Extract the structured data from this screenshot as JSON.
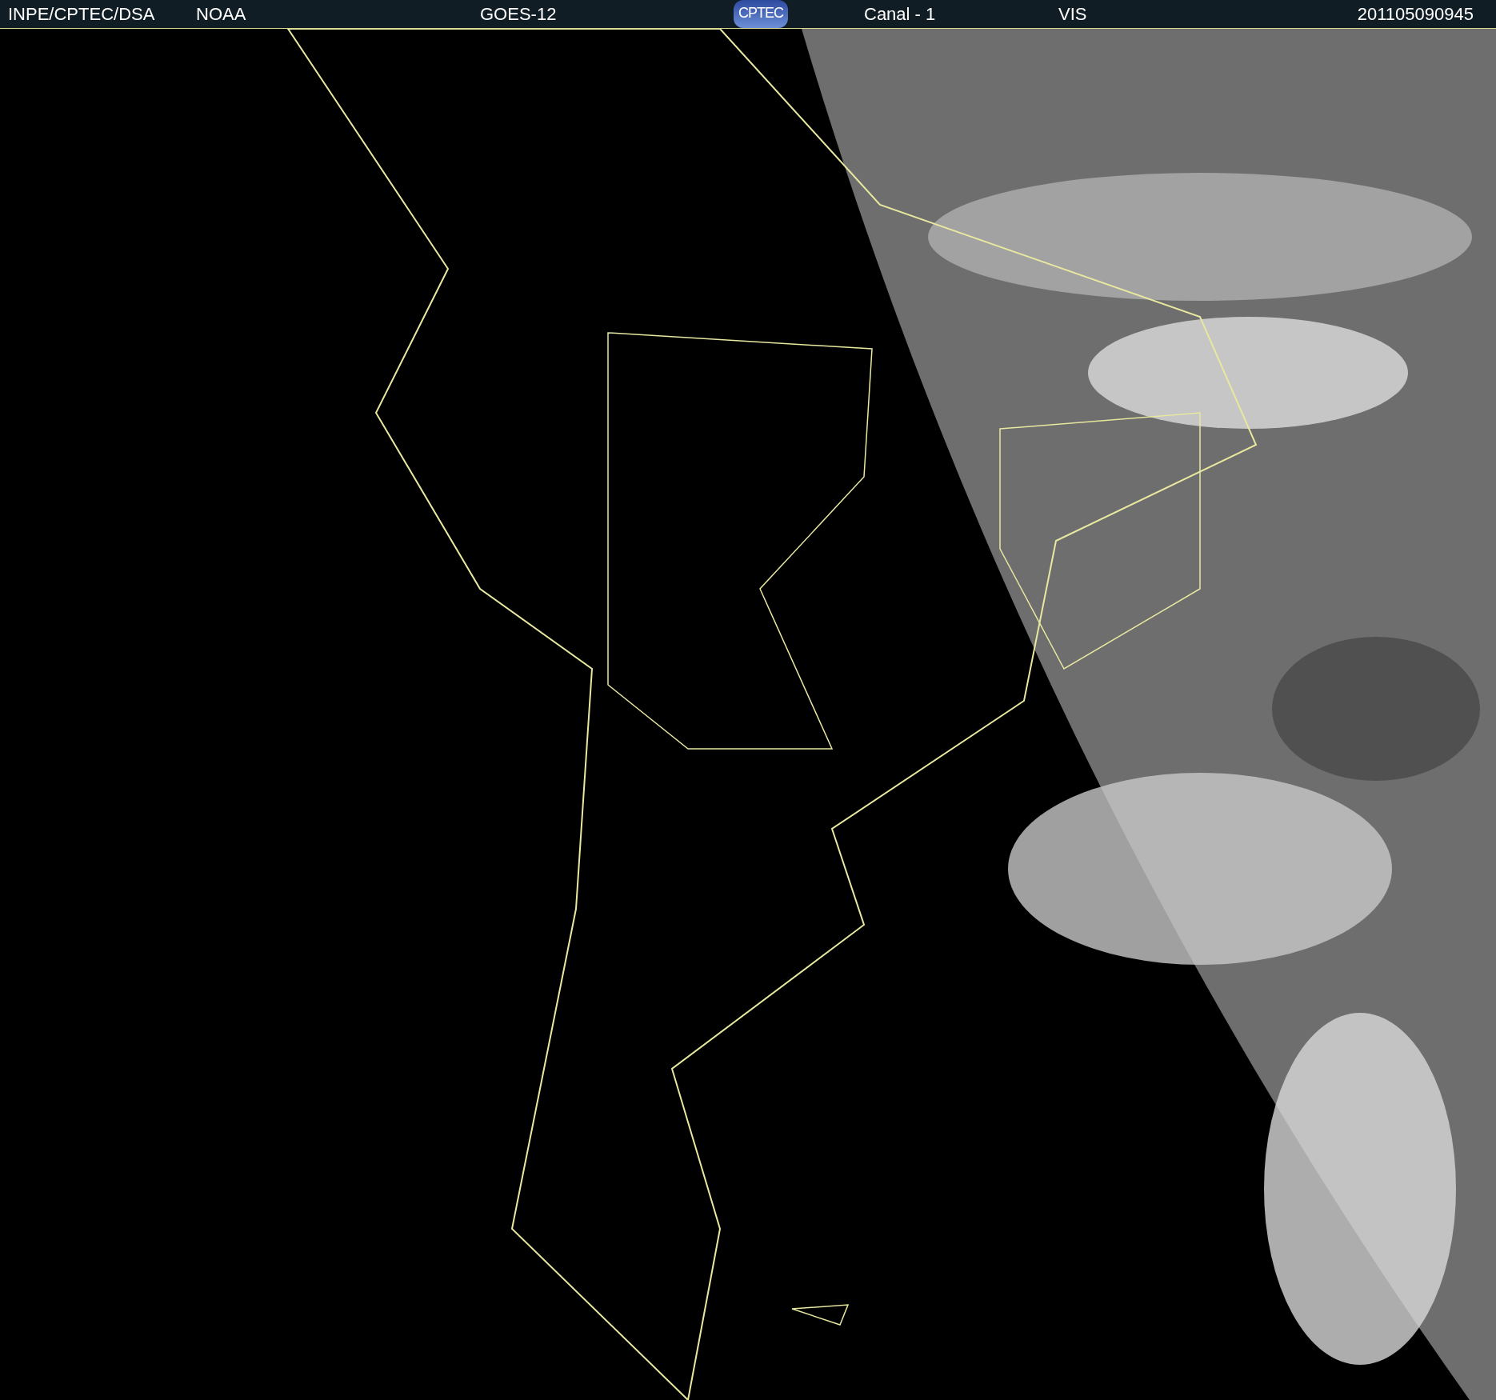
{
  "header": {
    "source": "INPE/CPTEC/DSA",
    "agency": "NOAA",
    "satellite": "GOES-12",
    "logo": "CPTEC",
    "channel": "Canal - 1",
    "band": "VIS",
    "timestamp": "201105090945"
  }
}
